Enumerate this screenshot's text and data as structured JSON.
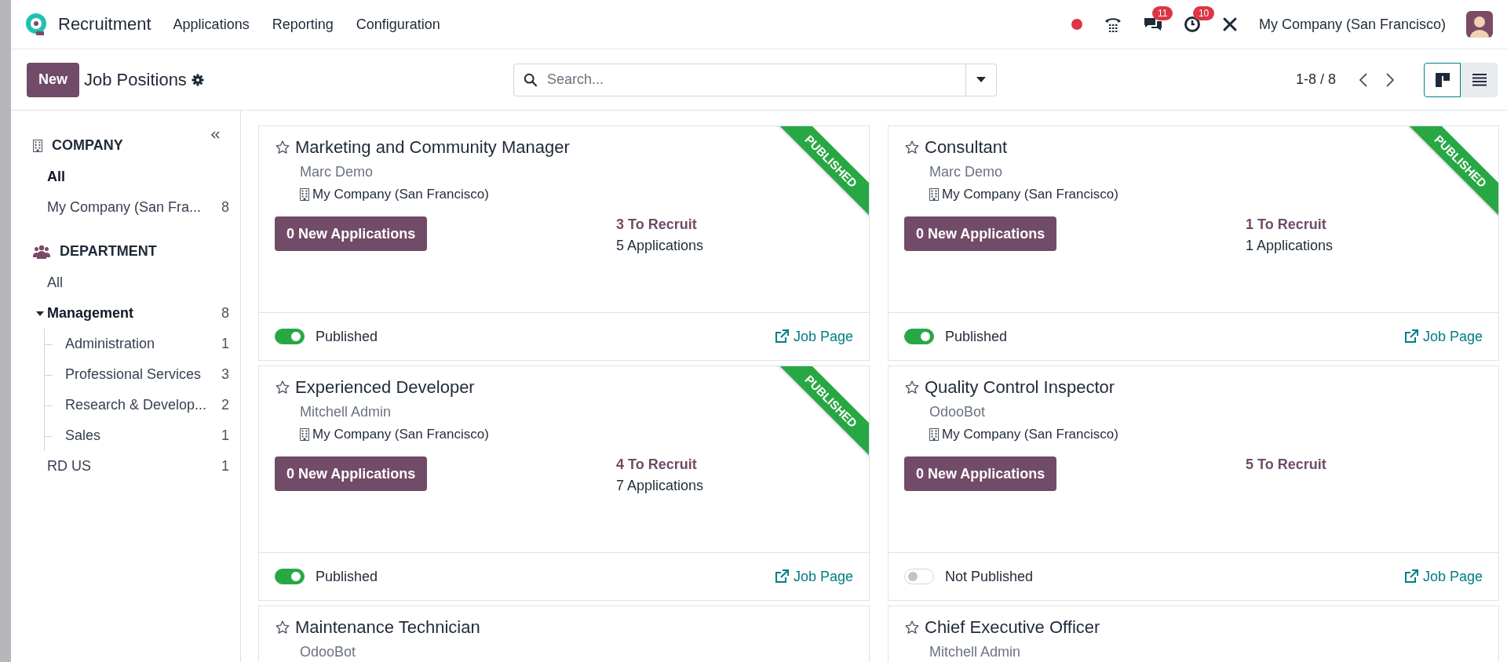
{
  "navbar": {
    "app_name": "Recruitment",
    "menus": [
      "Applications",
      "Reporting",
      "Configuration"
    ],
    "systray": {
      "chat_badge": "11",
      "activity_badge": "10",
      "company": "My Company (San Francisco)"
    }
  },
  "control_panel": {
    "new_button": "New",
    "breadcrumb": "Job Positions",
    "search": {
      "placeholder": "Search..."
    },
    "pager": "1-8 / 8",
    "views": [
      {
        "kind": "kanban",
        "selected": true
      },
      {
        "kind": "list",
        "selected": false
      }
    ]
  },
  "sidebar": {
    "sections": [
      {
        "kind": "company",
        "heading": "COMPANY",
        "items": [
          {
            "label": "All",
            "selected": true
          },
          {
            "label": "My Company (San Fra...",
            "count": "8",
            "selected": false
          }
        ]
      },
      {
        "kind": "department",
        "heading": "DEPARTMENT",
        "items": [
          {
            "label": "All",
            "selected": false
          },
          {
            "label": "Management",
            "count": "8",
            "selected": true,
            "expanded": true,
            "children": [
              {
                "label": "Administration",
                "count": "1",
                "selected": false
              },
              {
                "label": "Professional Services",
                "count": "3",
                "selected": false
              },
              {
                "label": "Research & Develop...",
                "count": "2",
                "selected": false
              },
              {
                "label": "Sales",
                "count": "1",
                "selected": false
              }
            ]
          },
          {
            "label": "RD US",
            "count": "1",
            "selected": false
          }
        ]
      }
    ]
  },
  "cards": [
    {
      "title": "Marketing and Community Manager",
      "person": "Marc Demo",
      "company": "My Company (San Francisco)",
      "new_applications": "0 New Applications",
      "to_recruit": "3 To Recruit",
      "applications": "5 Applications",
      "ribbon": "PUBLISHED",
      "published": true,
      "status": "Published",
      "link": "Job Page"
    },
    {
      "title": "Consultant",
      "person": "Marc Demo",
      "company": "My Company (San Francisco)",
      "new_applications": "0 New Applications",
      "to_recruit": "1 To Recruit",
      "applications": "1 Applications",
      "ribbon": "PUBLISHED",
      "published": true,
      "status": "Published",
      "link": "Job Page"
    },
    {
      "title": "Experienced Developer",
      "person": "Mitchell Admin",
      "company": "My Company (San Francisco)",
      "new_applications": "0 New Applications",
      "to_recruit": "4 To Recruit",
      "applications": "7 Applications",
      "ribbon": "PUBLISHED",
      "published": true,
      "status": "Published",
      "link": "Job Page"
    },
    {
      "title": "Quality Control Inspector",
      "person": "OdooBot",
      "company": "My Company (San Francisco)",
      "new_applications": "0 New Applications",
      "to_recruit": "5 To Recruit",
      "published": false,
      "status": "Not Published",
      "link": "Job Page"
    },
    {
      "title": "Maintenance Technician",
      "person": "OdooBot"
    },
    {
      "title": "Chief Executive Officer",
      "person": "Mitchell Admin"
    }
  ]
}
